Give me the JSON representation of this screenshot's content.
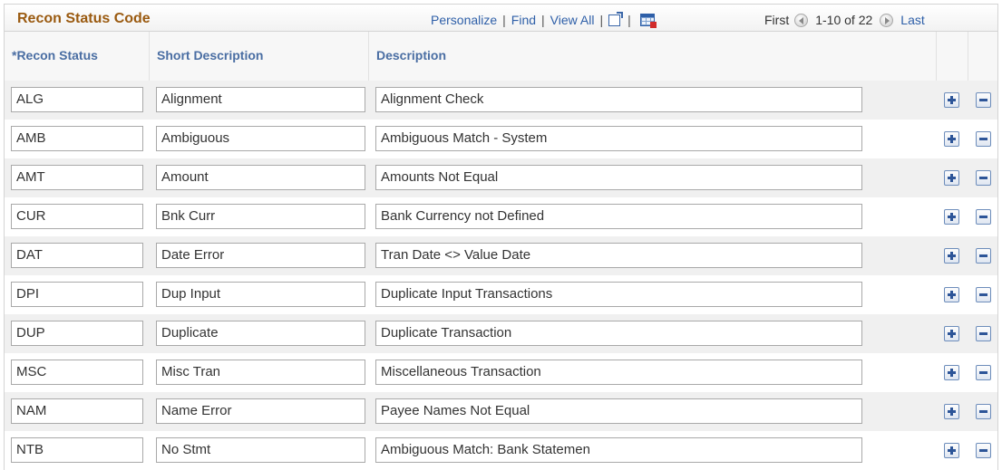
{
  "grid": {
    "title": "Recon Status Code",
    "nav": {
      "personalize": "Personalize",
      "find": "Find",
      "view_all": "View All",
      "zoom_icon": "zoom-icon",
      "download_icon": "grid-download-icon"
    },
    "paging": {
      "first": "First",
      "range": "1-10 of 22",
      "last": "Last"
    },
    "columns": {
      "recon_status": "*Recon Status",
      "short_description": "Short Description",
      "description": "Description"
    },
    "rows": [
      {
        "code": "ALG",
        "short": "Alignment",
        "desc": "Alignment Check"
      },
      {
        "code": "AMB",
        "short": "Ambiguous",
        "desc": "Ambiguous Match - System"
      },
      {
        "code": "AMT",
        "short": "Amount",
        "desc": "Amounts Not Equal"
      },
      {
        "code": "CUR",
        "short": "Bnk Curr",
        "desc": "Bank Currency not Defined"
      },
      {
        "code": "DAT",
        "short": "Date Error",
        "desc": "Tran Date <> Value Date"
      },
      {
        "code": "DPI",
        "short": "Dup Input",
        "desc": "Duplicate Input Transactions"
      },
      {
        "code": "DUP",
        "short": "Duplicate",
        "desc": "Duplicate Transaction"
      },
      {
        "code": "MSC",
        "short": "Misc Tran",
        "desc": "Miscellaneous Transaction"
      },
      {
        "code": "NAM",
        "short": "Name Error",
        "desc": "Payee Names Not Equal"
      },
      {
        "code": "NTB",
        "short": "No Stmt",
        "desc": "Ambiguous Match: Bank Statemen"
      }
    ],
    "colors": {
      "title": "#9a5a10",
      "link": "#2e5fa8",
      "header_text": "#4a6ea3"
    }
  }
}
